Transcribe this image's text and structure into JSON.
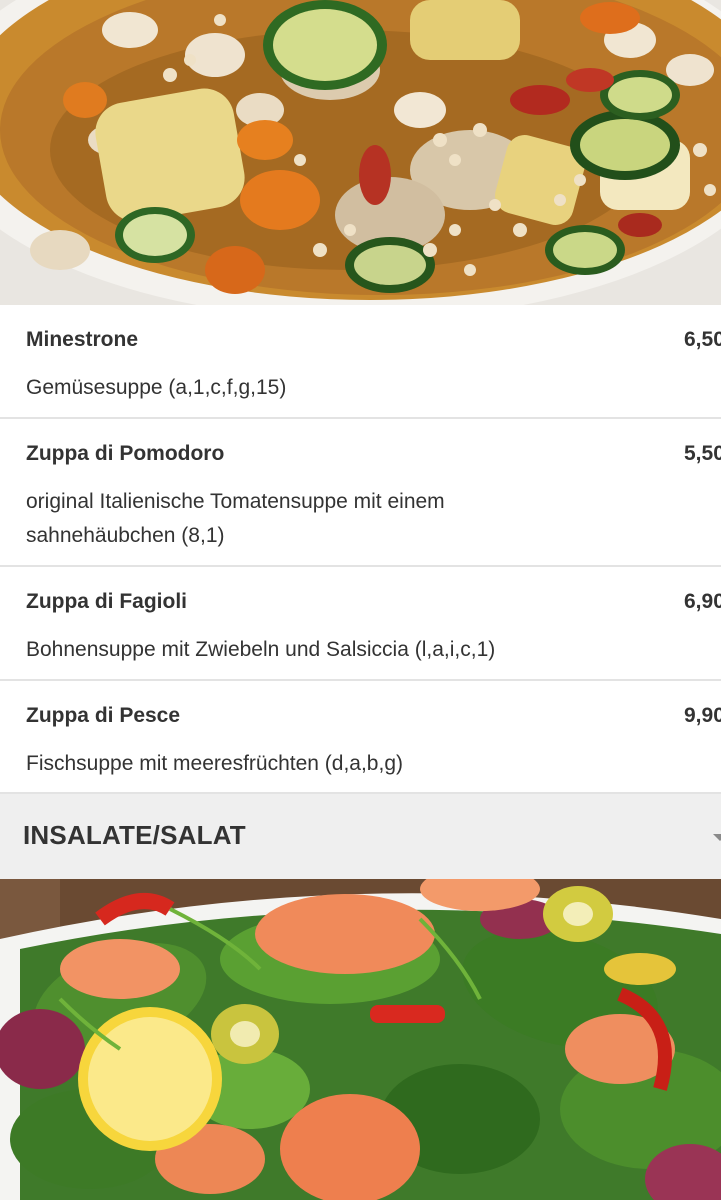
{
  "soups": {
    "items": [
      {
        "name": "Minestrone",
        "price": "6,50",
        "description": "Gemüsesuppe (a,1,c,f,g,15)"
      },
      {
        "name": "Zuppa di Pomodoro",
        "price": "5,50",
        "description": "original Italienische Tomatensuppe mit einem sahnehäubchen (8,1)"
      },
      {
        "name": "Zuppa di Fagioli",
        "price": "6,90",
        "description": "Bohnensuppe mit Zwiebeln und Salsiccia (l,a,i,c,1)"
      },
      {
        "name": "Zuppa di Pesce",
        "price": "9,90",
        "description": "Fischsuppe mit meeresfrüchten (d,a,b,g)"
      }
    ]
  },
  "salad_section": {
    "title": "INSALATE/SALAT",
    "toggle_icon": "chevron-down-icon"
  },
  "images": {
    "top": "soup-photo",
    "bottom": "salad-photo"
  }
}
